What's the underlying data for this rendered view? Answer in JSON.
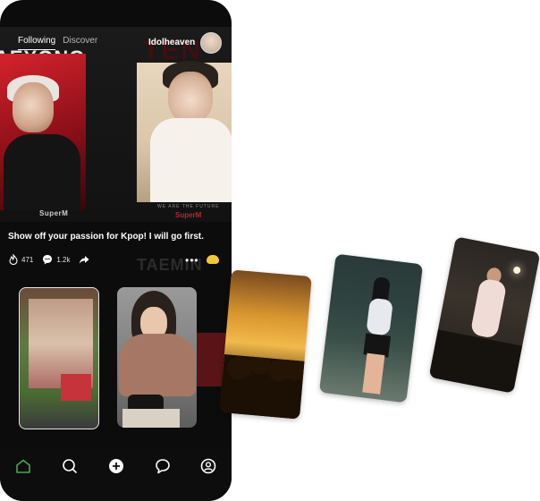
{
  "header": {
    "tabs": [
      {
        "label": "Following",
        "active": true
      },
      {
        "label": "Discover",
        "active": false
      }
    ],
    "username": "Idolheaven"
  },
  "hero": {
    "banner_left": "AEYONG",
    "banner_right": "TEN",
    "poster_left_label": "SuperM",
    "poster_right_label": "SuperM",
    "poster_right_tagline": "WE ARE THE FUTURE"
  },
  "post": {
    "caption": "Show off your passion for Kpop! I will go first.",
    "likes": "471",
    "comments": "1.2k",
    "more_label": "•••",
    "background_text": "TAEMIN"
  },
  "tiles": [
    {
      "name": "billboard-photo"
    },
    {
      "name": "fan-photo"
    }
  ],
  "navbar": {
    "items": [
      "home-icon",
      "search-icon",
      "add-icon",
      "chat-icon",
      "profile-icon"
    ],
    "active": "home-icon",
    "accent": "#4ca84a"
  },
  "floating_cards": [
    {
      "name": "concert-crowd-card"
    },
    {
      "name": "dancer-card"
    },
    {
      "name": "singer-card"
    }
  ]
}
